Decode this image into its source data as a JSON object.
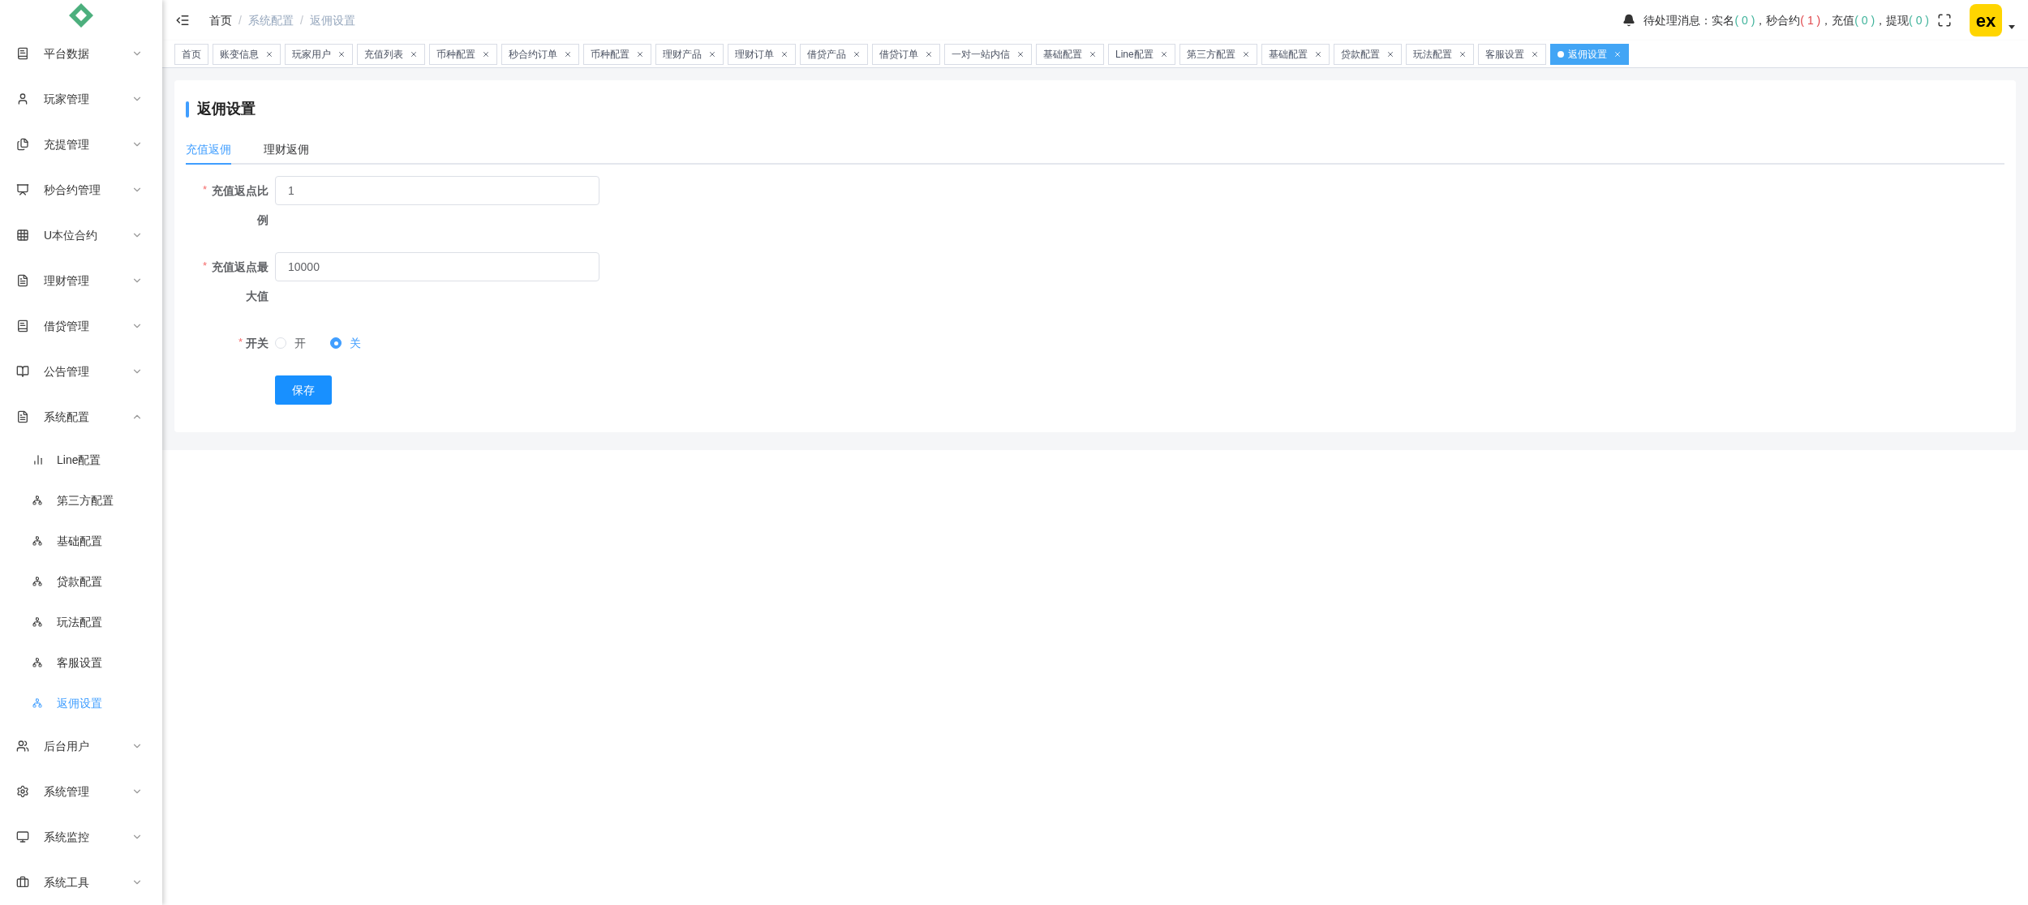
{
  "sidebar": {
    "items": [
      {
        "label": "平台数据",
        "expanded": false
      },
      {
        "label": "玩家管理",
        "expanded": false
      },
      {
        "label": "充提管理",
        "expanded": false
      },
      {
        "label": "秒合约管理",
        "expanded": false
      },
      {
        "label": "U本位合约",
        "expanded": false
      },
      {
        "label": "理财管理",
        "expanded": false
      },
      {
        "label": "借贷管理",
        "expanded": false
      },
      {
        "label": "公告管理",
        "expanded": false
      },
      {
        "label": "系统配置",
        "expanded": true,
        "children": [
          {
            "label": "Line配置",
            "selected": false
          },
          {
            "label": "第三方配置",
            "selected": false
          },
          {
            "label": "基础配置",
            "selected": false
          },
          {
            "label": "贷款配置",
            "selected": false
          },
          {
            "label": "玩法配置",
            "selected": false
          },
          {
            "label": "客服设置",
            "selected": false
          },
          {
            "label": "返佣设置",
            "selected": true
          }
        ]
      },
      {
        "label": "后台用户",
        "expanded": false
      },
      {
        "label": "系统管理",
        "expanded": false
      },
      {
        "label": "系统监控",
        "expanded": false
      },
      {
        "label": "系统工具",
        "expanded": false
      }
    ]
  },
  "breadcrumb": [
    {
      "kind": "link",
      "text": "首页"
    },
    {
      "kind": "separator",
      "text": "/"
    },
    {
      "kind": "link",
      "text": "系统配置"
    },
    {
      "kind": "separator",
      "text": "/"
    },
    {
      "kind": "current",
      "text": "返佣设置"
    }
  ],
  "notifications": {
    "title": "待处理消息：",
    "items": [
      {
        "label": "实名",
        "count": "( 0 )",
        "color": "#3fb39b"
      },
      {
        "label": "，秒合约",
        "count": "( 1 )",
        "color": "#e0464b"
      },
      {
        "label": "，充值",
        "count": "( 0 )",
        "color": "#3fb39b"
      },
      {
        "label": "，提现",
        "count": "( 0 )",
        "color": "#3fb39b"
      }
    ]
  },
  "avatar_text": "ex",
  "tabs": [
    {
      "label": "首页",
      "closable": false,
      "selected": false
    },
    {
      "label": "账变信息",
      "closable": true,
      "selected": false
    },
    {
      "label": "玩家用户",
      "closable": true,
      "selected": false
    },
    {
      "label": "充值列表",
      "closable": true,
      "selected": false
    },
    {
      "label": "币种配置",
      "closable": true,
      "selected": false
    },
    {
      "label": "秒合约订单",
      "closable": true,
      "selected": false
    },
    {
      "label": "币种配置",
      "closable": true,
      "selected": false
    },
    {
      "label": "理财产品",
      "closable": true,
      "selected": false
    },
    {
      "label": "理财订单",
      "closable": true,
      "selected": false
    },
    {
      "label": "借贷产品",
      "closable": true,
      "selected": false
    },
    {
      "label": "借贷订单",
      "closable": true,
      "selected": false
    },
    {
      "label": "一对一站内信",
      "closable": true,
      "selected": false
    },
    {
      "label": "基础配置",
      "closable": true,
      "selected": false
    },
    {
      "label": "Line配置",
      "closable": true,
      "selected": false
    },
    {
      "label": "第三方配置",
      "closable": true,
      "selected": false
    },
    {
      "label": "基础配置",
      "closable": true,
      "selected": false
    },
    {
      "label": "贷款配置",
      "closable": true,
      "selected": false
    },
    {
      "label": "玩法配置",
      "closable": true,
      "selected": false
    },
    {
      "label": "客服设置",
      "closable": true,
      "selected": false
    },
    {
      "label": "返佣设置",
      "closable": true,
      "selected": true
    }
  ],
  "card": {
    "title": "返佣设置",
    "tabs": [
      {
        "label": "充值返佣",
        "selected": true
      },
      {
        "label": "理财返佣",
        "selected": false
      }
    ],
    "fields": [
      {
        "kind": "input",
        "label": "充值返点比例",
        "required_mark": "*",
        "value": "1"
      },
      {
        "kind": "input",
        "label": "充值返点最大值",
        "required_mark": "*",
        "value": "10000"
      },
      {
        "kind": "radio",
        "label": "开关",
        "required_mark": "*",
        "options": [
          {
            "label": "开",
            "selected": false
          },
          {
            "label": "关",
            "selected": true
          }
        ]
      }
    ],
    "save_button": "保存"
  }
}
